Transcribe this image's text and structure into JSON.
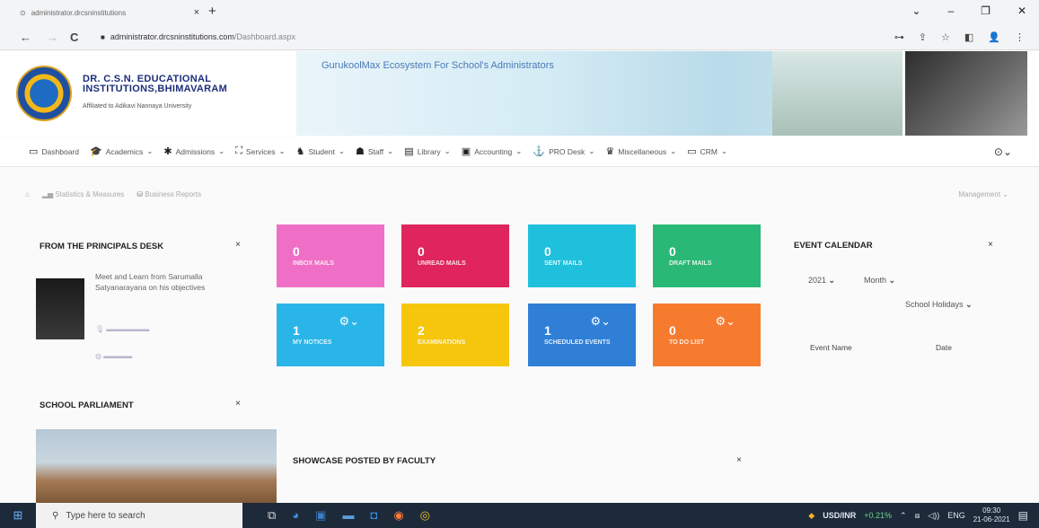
{
  "browser": {
    "tab_title": "administrator.drcsninstitutions",
    "tab_close": "×",
    "new_tab": "+",
    "back": "←",
    "forward": "→",
    "reload": "C",
    "url_host": "administrator.drcsninstitutions.com",
    "url_path": "/Dashboard.aspx"
  },
  "header": {
    "institution_name_line1": "DR. C.S.N. EDUCATIONAL",
    "institution_name_line2": "INSTITUTIONS,BHIMAVARAM",
    "affiliation": "Affiliated to Adikavi Nannaya University",
    "tagline": "GurukoolMax Ecosystem For School's Administrators"
  },
  "menu": [
    {
      "label": "Dashboard",
      "icon": "monitor-icon",
      "glyph": "▭",
      "dropdown": false
    },
    {
      "label": "Academics",
      "icon": "graduation-cap-icon",
      "glyph": "🎓",
      "dropdown": true
    },
    {
      "label": "Admissions",
      "icon": "admissions-icon",
      "glyph": "✱",
      "dropdown": true
    },
    {
      "label": "Services",
      "icon": "services-icon",
      "glyph": "⛶",
      "dropdown": true
    },
    {
      "label": "Student",
      "icon": "student-icon",
      "glyph": "♞",
      "dropdown": true
    },
    {
      "label": "Staff",
      "icon": "staff-icon",
      "glyph": "☗",
      "dropdown": true
    },
    {
      "label": "Library",
      "icon": "library-icon",
      "glyph": "▤",
      "dropdown": true
    },
    {
      "label": "Accounting",
      "icon": "accounting-icon",
      "glyph": "▣",
      "dropdown": true
    },
    {
      "label": "PRO Desk",
      "icon": "pro-desk-icon",
      "glyph": "⚓",
      "dropdown": true
    },
    {
      "label": "Miscellaneous",
      "icon": "miscellaneous-icon",
      "glyph": "♛",
      "dropdown": true
    },
    {
      "label": "CRM",
      "icon": "crm-icon",
      "glyph": "▭",
      "dropdown": true
    }
  ],
  "breadcrumbs": {
    "items": [
      "Statistics & Measures",
      "Business Reports"
    ],
    "management": "Management"
  },
  "principal_desk": {
    "title": "FROM THE PRINCIPALS DESK",
    "close": "×",
    "text": "Meet and Learn from Sarumalla Satyanarayana on his objectives"
  },
  "school_parliament": {
    "title": "SCHOOL PARLIAMENT",
    "close": "×"
  },
  "tiles": [
    {
      "value": "0",
      "label": "INBOX MAILS",
      "color": "#f06fc6",
      "gear": false
    },
    {
      "value": "0",
      "label": "UNREAD MAILS",
      "color": "#e0245e",
      "gear": false
    },
    {
      "value": "0",
      "label": "SENT MAILS",
      "color": "#1fc0dc",
      "gear": false
    },
    {
      "value": "0",
      "label": "DRAFT MAILS",
      "color": "#2ab876",
      "gear": false
    },
    {
      "value": "1",
      "label": "My Notices",
      "color": "#2ab5e8",
      "gear": true
    },
    {
      "value": "2",
      "label": "Examinations",
      "color": "#f5c60c",
      "gear": false
    },
    {
      "value": "1",
      "label": "Scheduled Events",
      "color": "#2f7fd6",
      "gear": true
    },
    {
      "value": "0",
      "label": "To do List",
      "color": "#f77b2f",
      "gear": true
    }
  ],
  "showcase": {
    "title": "SHOWCASE POSTED BY FACULTY",
    "close": "×"
  },
  "event_calendar": {
    "title": "EVENT CALENDAR",
    "close": "×",
    "year": "2021",
    "period": "Month",
    "filter": "School Holidays",
    "columns": [
      "Event Name",
      "Date"
    ]
  },
  "taskbar": {
    "search_placeholder": "Type here to search",
    "ticker_label": "USD/INR",
    "ticker_change": "+0.21%",
    "language": "ENG",
    "time": "09:30",
    "date": "21-06-2021"
  },
  "colors": {
    "brand_navy": "#1c2f7a",
    "taskbar": "#1d2a3a"
  }
}
